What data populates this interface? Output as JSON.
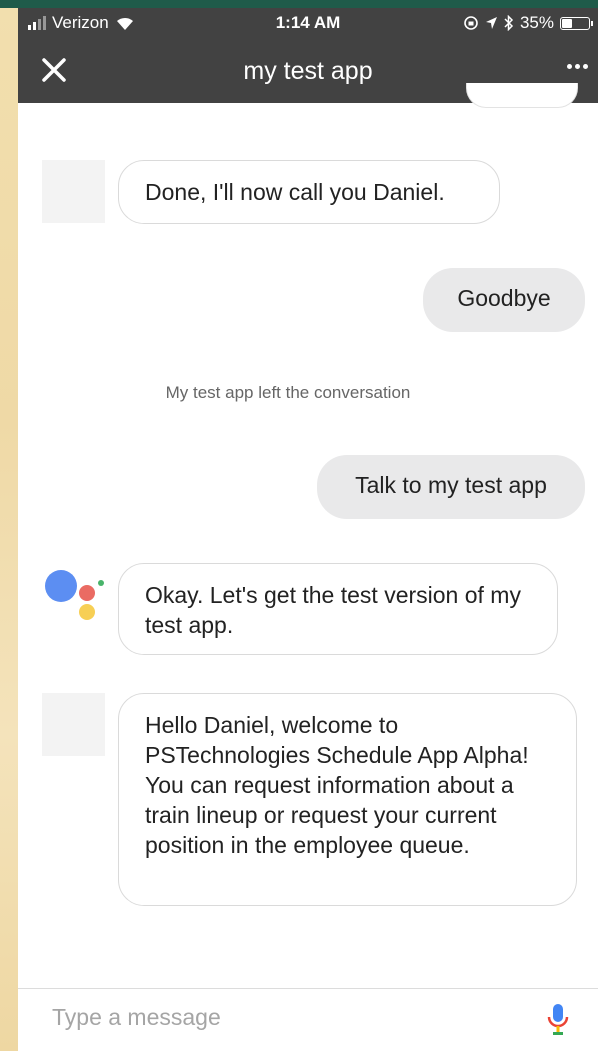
{
  "status_bar": {
    "carrier": "Verizon",
    "time": "1:14 AM",
    "battery_text": "35%",
    "battery_level": 0.35,
    "icons": [
      "signal-icon",
      "wifi-icon",
      "rotation-lock-icon",
      "location-icon",
      "bluetooth-icon",
      "battery-icon"
    ]
  },
  "app_bar": {
    "title": "my test app",
    "close_icon": "close-icon",
    "more_icon": "more-horizontal-icon"
  },
  "messages": [
    {
      "sender": "app",
      "text": "Done, I'll now call you Daniel."
    },
    {
      "sender": "user",
      "text": "Goodbye"
    },
    {
      "sender": "system",
      "text": "My test app left the conversation"
    },
    {
      "sender": "user",
      "text": "Talk to my test app"
    },
    {
      "sender": "assistant",
      "text": "Okay. Let's get the test version of my test app."
    },
    {
      "sender": "app",
      "text": "Hello Daniel, welcome to PSTechnologies Schedule App Alpha! You can request information about a train lineup or request your current position in the employee queue."
    }
  ],
  "composer": {
    "placeholder": "Type a message",
    "mic_icon": "microphone-icon"
  },
  "colors": {
    "app_bar": "#424242",
    "user_bubble": "#e9e9ea",
    "assistant_blue": "#5c8ef2",
    "assistant_red": "#ea6b63",
    "assistant_yellow": "#f7cf55",
    "assistant_green": "#48b46a"
  }
}
